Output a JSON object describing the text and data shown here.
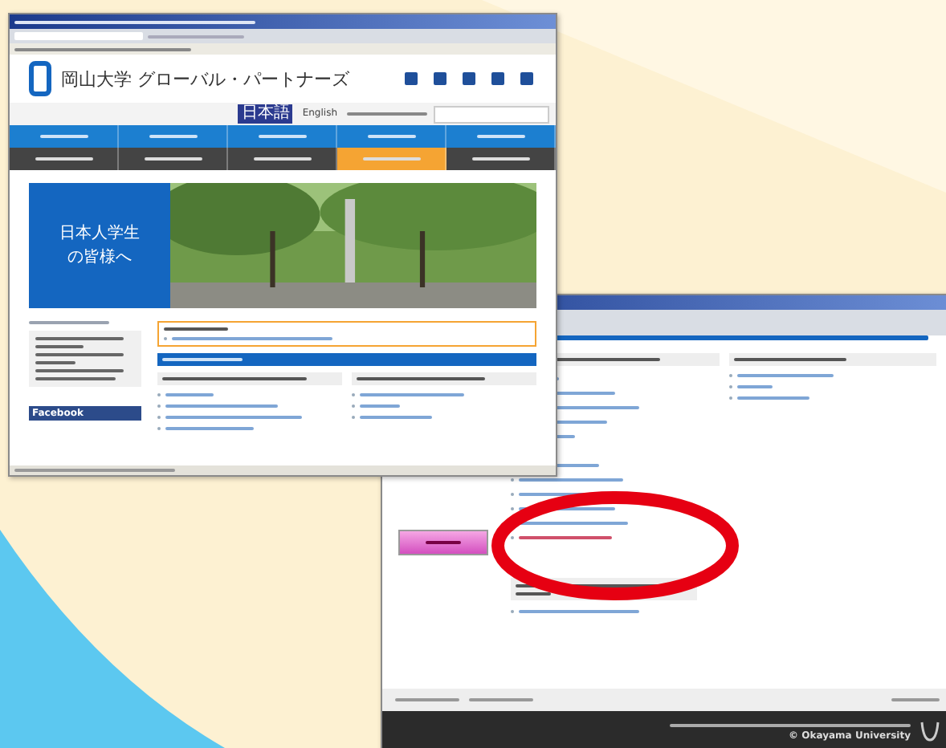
{
  "windows": [
    {
      "kind": "site-home",
      "site_title": "岡山大学 グローバル・パートナーズ",
      "languages": [
        {
          "label": "日本語",
          "selected": true
        },
        {
          "label": "English",
          "selected": false
        }
      ],
      "nav_secondary": [
        {
          "selected": false
        },
        {
          "selected": false
        },
        {
          "selected": false
        },
        {
          "selected": true
        },
        {
          "selected": false
        }
      ],
      "banner_heading": "日本人学生の皆様へ",
      "social_heading": "Facebook"
    },
    {
      "kind": "site-page",
      "copyright": "© Okayama University"
    }
  ]
}
